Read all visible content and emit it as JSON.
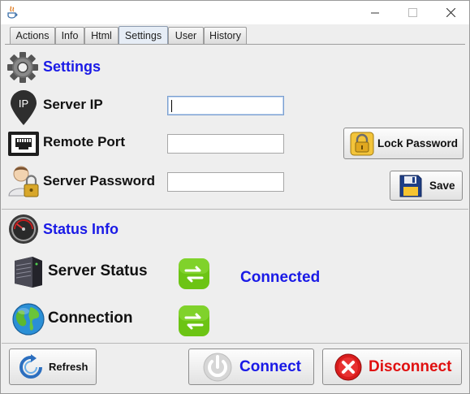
{
  "window": {
    "controls": {
      "minimize": "—",
      "maximize": "☐",
      "close": "✕"
    }
  },
  "tabs": [
    {
      "label": "Actions",
      "active": false
    },
    {
      "label": "Info",
      "active": false
    },
    {
      "label": "Html",
      "active": false
    },
    {
      "label": "Settings",
      "active": true
    },
    {
      "label": "User",
      "active": false
    },
    {
      "label": "History",
      "active": false
    }
  ],
  "settings": {
    "title": "Settings",
    "icon": "gear-icon",
    "server_ip": {
      "label": "Server IP",
      "value": "",
      "icon": "location-pin-ip-icon",
      "icon_text": "IP"
    },
    "remote_port": {
      "label": "Remote Port",
      "value": "",
      "icon": "network-port-icon"
    },
    "server_password": {
      "label": "Server Password",
      "value": "",
      "icon": "user-lock-icon"
    },
    "lock_password_button": {
      "label": "Lock Password",
      "icon": "padlock-icon"
    },
    "save_button": {
      "label": "Save",
      "icon": "floppy-disk-icon"
    }
  },
  "status_info": {
    "title": "Status Info",
    "icon": "gauge-icon",
    "server_status": {
      "label": "Server Status",
      "icon": "server-tower-icon",
      "indicator_icon": "sync-arrows-icon",
      "value": "Connected"
    },
    "connection": {
      "label": "Connection",
      "icon": "globe-icon",
      "indicator_icon": "sync-arrows-icon"
    }
  },
  "footer": {
    "refresh_button": {
      "label": "Refresh",
      "icon": "refresh-icon"
    },
    "connect_button": {
      "label": "Connect",
      "icon": "power-icon"
    },
    "disconnect_button": {
      "label": "Disconnect",
      "icon": "close-circle-icon"
    }
  },
  "colors": {
    "accent_blue": "#1a1ae6",
    "disconnect_red": "#e01010",
    "indicator_green": "#6cc414"
  }
}
